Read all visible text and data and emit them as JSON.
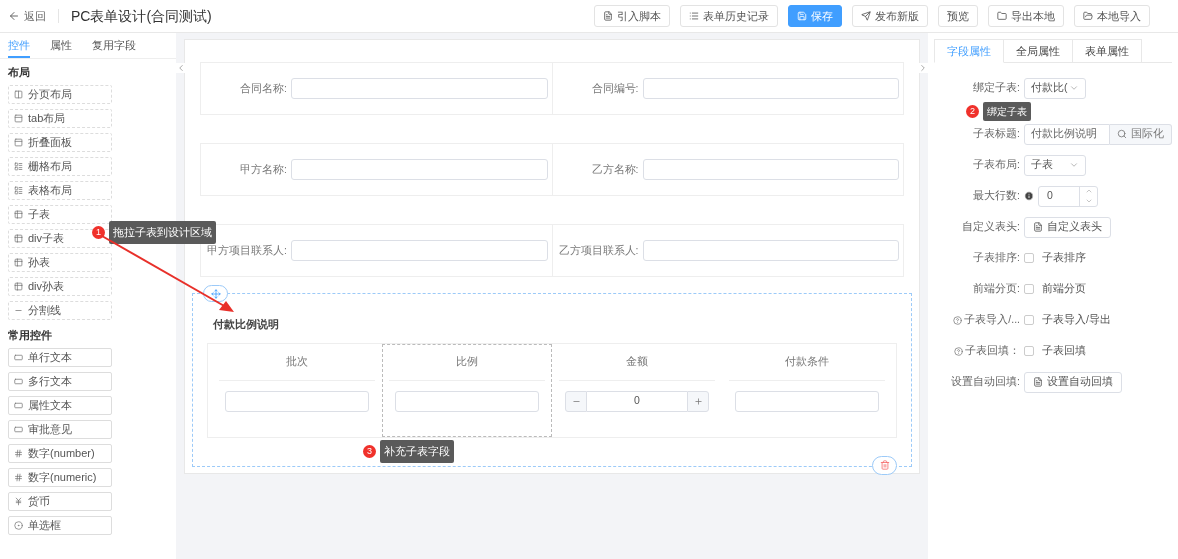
{
  "header": {
    "back": "返回",
    "title": "PC表单设计(合同测试)",
    "buttons": [
      {
        "label": "引入脚本",
        "kind": "default"
      },
      {
        "label": "表单历史记录",
        "kind": "default"
      },
      {
        "label": "保存",
        "kind": "primary"
      },
      {
        "label": "发布新版",
        "kind": "default"
      },
      {
        "label": "预览",
        "kind": "default"
      },
      {
        "label": "导出本地",
        "kind": "default"
      },
      {
        "label": "本地导入",
        "kind": "default"
      }
    ]
  },
  "sidebar": {
    "tabs": [
      {
        "label": "控件",
        "selected": true
      },
      {
        "label": "属性",
        "selected": false
      },
      {
        "label": "复用字段",
        "selected": false
      }
    ],
    "sections": [
      {
        "title": "布局",
        "items": [
          {
            "label": "分页布局"
          },
          {
            "label": "tab布局"
          },
          {
            "label": "折叠面板"
          },
          {
            "label": "栅格布局"
          },
          {
            "label": "表格布局"
          },
          {
            "label": "子表"
          },
          {
            "label": "div子表"
          },
          {
            "label": "孙表"
          },
          {
            "label": "div孙表"
          },
          {
            "label": "分割线"
          }
        ]
      },
      {
        "title": "常用控件",
        "items": [
          {
            "label": "单行文本"
          },
          {
            "label": "多行文本"
          },
          {
            "label": "属性文本"
          },
          {
            "label": "审批意见"
          },
          {
            "label": "数字(number)"
          },
          {
            "label": "数字(numeric)"
          },
          {
            "label": "货币"
          },
          {
            "label": "单选框"
          }
        ]
      }
    ]
  },
  "form": {
    "rows": [
      [
        {
          "label": "合同名称:"
        },
        {
          "label": "合同编号:"
        }
      ],
      [
        {
          "label": "甲方名称:"
        },
        {
          "label": "乙方名称:"
        }
      ],
      [
        {
          "label": "甲方项目联系人:"
        },
        {
          "label": "乙方项目联系人:"
        }
      ]
    ],
    "subtable": {
      "title": "付款比例说明",
      "columns": [
        {
          "header": "批次",
          "kind": "text",
          "selected": false
        },
        {
          "header": "比例",
          "kind": "text",
          "selected": true
        },
        {
          "header": "金额",
          "kind": "number",
          "value": "0",
          "selected": false
        },
        {
          "header": "付款条件",
          "kind": "text",
          "selected": false
        }
      ]
    }
  },
  "properties": {
    "tabs": [
      {
        "label": "字段属性",
        "selected": true
      },
      {
        "label": "全局属性",
        "selected": false
      },
      {
        "label": "表单属性",
        "selected": false
      }
    ],
    "rows": [
      {
        "label": "绑定子表:",
        "kind": "select",
        "value": "付款比("
      },
      {
        "label": "子表标题:",
        "kind": "i18n",
        "value": "付款比例说明",
        "button": "国际化"
      },
      {
        "label": "子表布局:",
        "kind": "select",
        "value": "子表"
      },
      {
        "label": "最大行数:",
        "kind": "number",
        "value": "0",
        "info": true
      },
      {
        "label": "自定义表头:",
        "kind": "button",
        "button": "自定义表头"
      },
      {
        "label": "子表排序:",
        "kind": "checkbox",
        "text": "子表排序",
        "checked": false,
        "help": false
      },
      {
        "label": "前端分页:",
        "kind": "checkbox",
        "text": "前端分页",
        "checked": false,
        "help": false
      },
      {
        "label": "子表导入/...",
        "kind": "checkbox",
        "text": "子表导入/导出",
        "checked": false,
        "help": true
      },
      {
        "label": "子表回填：",
        "kind": "checkbox",
        "text": "子表回填",
        "checked": false,
        "help": true
      },
      {
        "label": "设置自动回填:",
        "kind": "button",
        "button": "设置自动回填"
      }
    ]
  },
  "callouts": [
    {
      "number": "1",
      "text": "拖拉子表到设计区域"
    },
    {
      "number": "2",
      "text": "绑定子表"
    },
    {
      "number": "3",
      "text": "补充子表字段"
    }
  ]
}
